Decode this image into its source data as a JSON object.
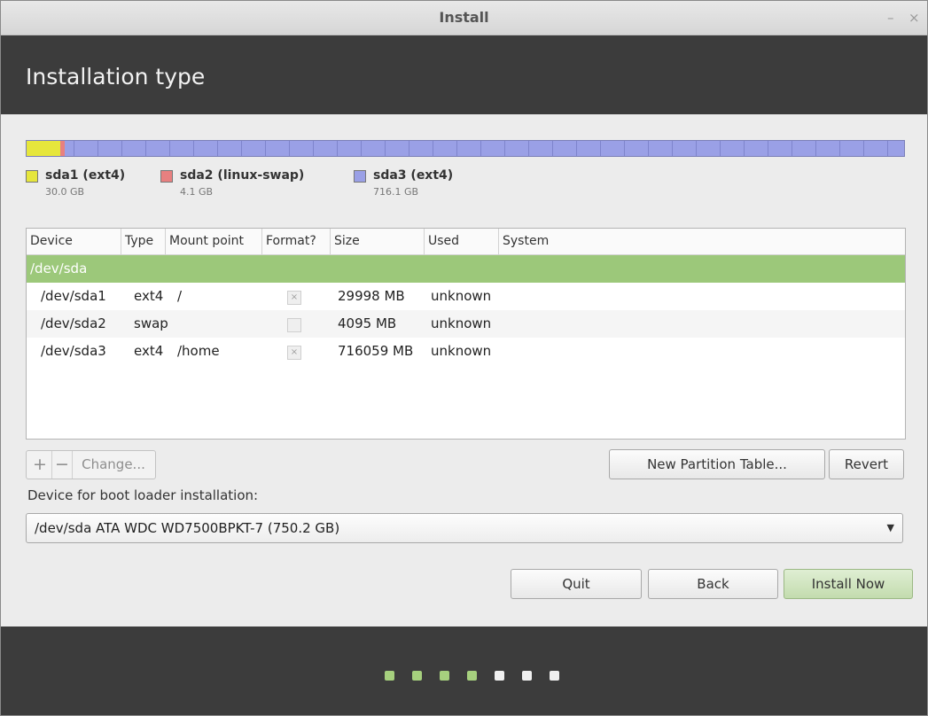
{
  "window": {
    "title": "Install",
    "minimize": "–",
    "close": "×"
  },
  "header": {
    "title": "Installation type"
  },
  "partitions": [
    {
      "name": "sda1 (ext4)",
      "size": "30.0 GB",
      "color": "#e6e63c"
    },
    {
      "name": "sda2 (linux-swap)",
      "size": "4.1 GB",
      "color": "#e88080"
    },
    {
      "name": "sda3 (ext4)",
      "size": "716.1 GB",
      "color": "#9aa0e6"
    }
  ],
  "table": {
    "columns": [
      "Device",
      "Type",
      "Mount point",
      "Format?",
      "Size",
      "Used",
      "System"
    ],
    "group": "/dev/sda",
    "rows": [
      {
        "device": "/dev/sda1",
        "type": "ext4",
        "mount": "/",
        "format": "×",
        "size": "29998 MB",
        "used": "unknown",
        "system": ""
      },
      {
        "device": "/dev/sda2",
        "type": "swap",
        "mount": "",
        "format": "",
        "size": "4095 MB",
        "used": "unknown",
        "system": ""
      },
      {
        "device": "/dev/sda3",
        "type": "ext4",
        "mount": "/home",
        "format": "×",
        "size": "716059 MB",
        "used": "unknown",
        "system": ""
      }
    ]
  },
  "toolbar": {
    "add": "+",
    "remove": "−",
    "change": "Change...",
    "new_table": "New Partition Table...",
    "revert": "Revert"
  },
  "boot_loader": {
    "label": "Device for boot loader installation:",
    "value": "/dev/sda   ATA WDC WD7500BPKT-7 (750.2 GB)",
    "arrow": "▼"
  },
  "buttons": {
    "quit": "Quit",
    "back": "Back",
    "install": "Install Now"
  },
  "progress": {
    "total_steps": 7,
    "completed_steps": 4,
    "done_color": "#a6d07e",
    "todo_color": "#f0f0f0"
  },
  "colors": {
    "header_bg": "#3c3c3c",
    "selected_row": "#9cc87a",
    "accent": "#9cc87a"
  }
}
